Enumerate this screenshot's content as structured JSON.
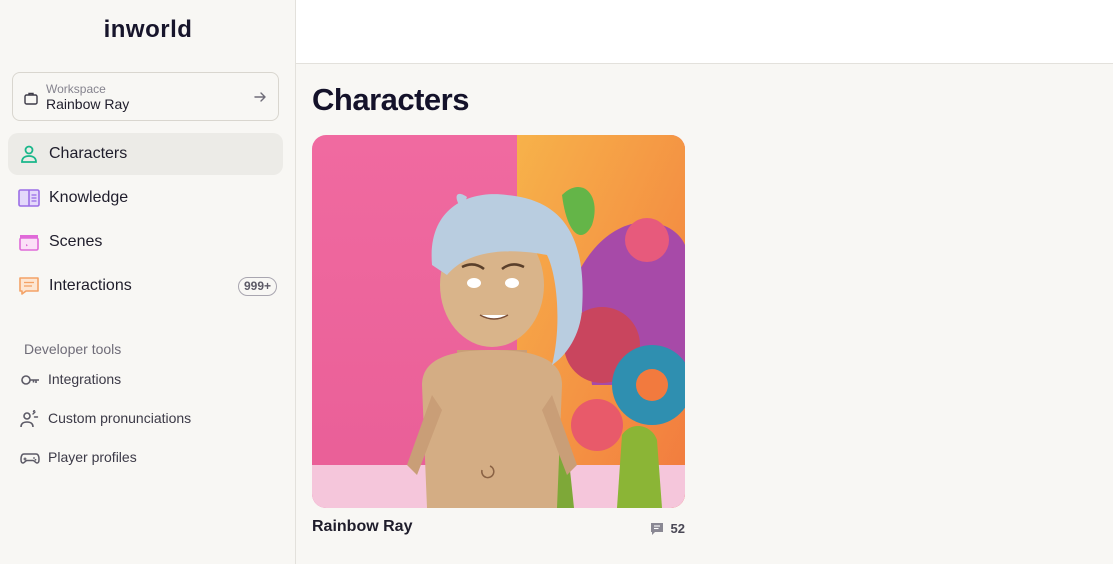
{
  "app": {
    "logo_text": "inworld"
  },
  "workspace": {
    "label": "Workspace",
    "value": "Rainbow Ray",
    "icon": "briefcase-icon",
    "action_icon": "arrow-right-icon"
  },
  "nav": {
    "items": [
      {
        "label": "Characters",
        "icon": "person-icon",
        "active": true,
        "color": "#19b78a"
      },
      {
        "label": "Knowledge",
        "icon": "book-icon",
        "color": "#9b6ee6"
      },
      {
        "label": "Scenes",
        "icon": "clapperboard-icon",
        "color": "#e06ad8"
      },
      {
        "label": "Interactions",
        "icon": "chat-icon",
        "color": "#f4a266",
        "badge": "999+"
      }
    ]
  },
  "developer_tools": {
    "title": "Developer tools",
    "items": [
      {
        "label": "Integrations",
        "icon": "key-icon"
      },
      {
        "label": "Custom pronunciations",
        "icon": "speaking-person-icon"
      },
      {
        "label": "Player profiles",
        "icon": "gamepad-icon"
      }
    ]
  },
  "main": {
    "title": "Characters",
    "cards": [
      {
        "name": "Rainbow Ray",
        "interaction_count": "52",
        "count_icon": "chat-bubble-icon"
      }
    ]
  }
}
